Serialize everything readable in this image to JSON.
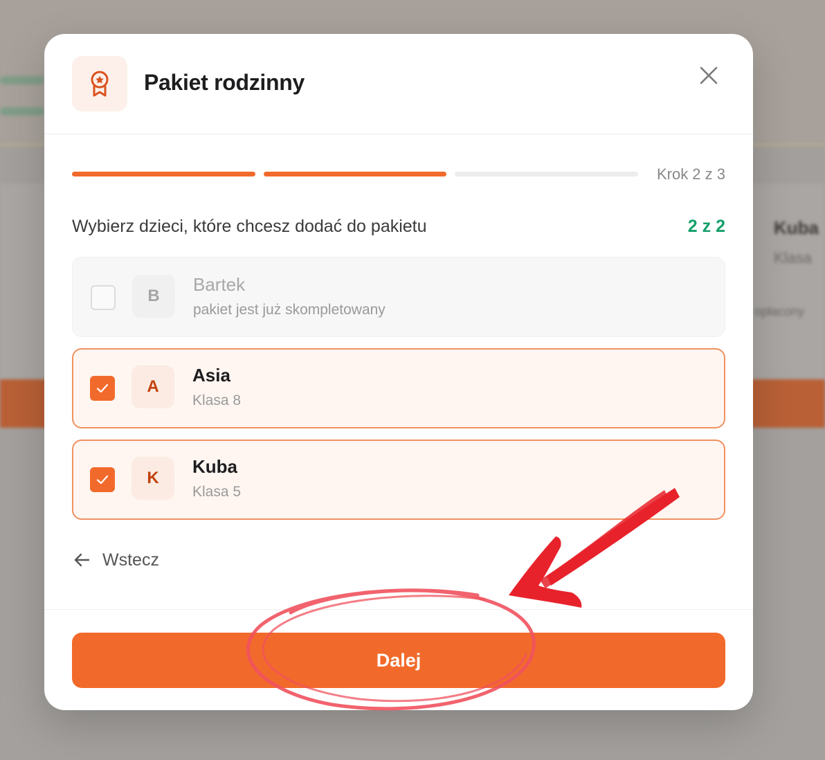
{
  "background": {
    "right_card_name": "Kuba",
    "right_card_sub": "Klasa",
    "right_card_tag": "opłacony"
  },
  "modal": {
    "title": "Pakiet rodzinny",
    "header_icon": "award-badge-icon",
    "close_icon": "close-icon",
    "progress": {
      "current_step": 2,
      "total_steps": 3,
      "label": "Krok 2 z 3"
    },
    "subtitle": "Wybierz dzieci, które chcesz dodać do pakietu",
    "selected_count": "2 z 2",
    "children": [
      {
        "initial": "B",
        "name": "Bartek",
        "sub": "pakiet jest już skompletowany",
        "checked": false,
        "disabled": true
      },
      {
        "initial": "A",
        "name": "Asia",
        "sub": "Klasa 8",
        "checked": true,
        "disabled": false
      },
      {
        "initial": "K",
        "name": "Kuba",
        "sub": "Klasa 5",
        "checked": true,
        "disabled": false
      }
    ],
    "back_label": "Wstecz",
    "next_label": "Dalej"
  },
  "colors": {
    "accent": "#f26a2b",
    "success": "#14a06a",
    "annotation_red": "#e8222b"
  }
}
